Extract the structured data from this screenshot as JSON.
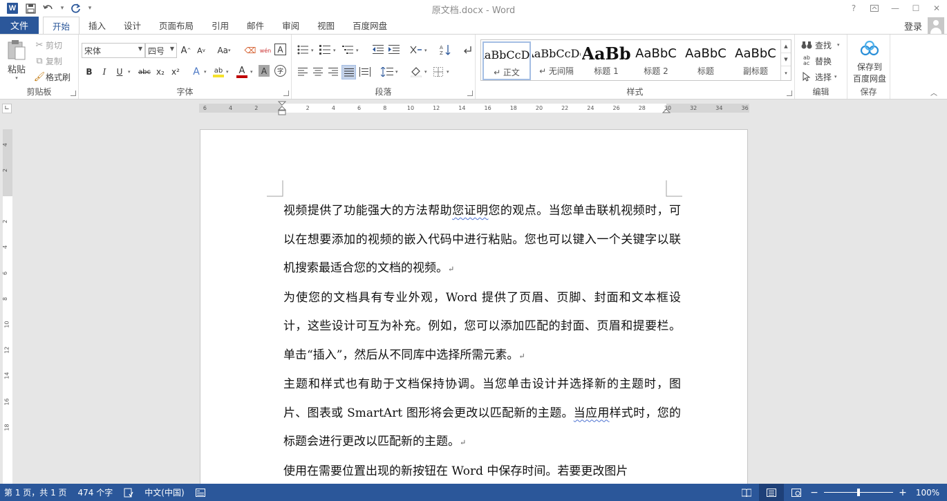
{
  "window": {
    "title": "原文档.docx - Word",
    "help_icon": "?",
    "ribbon_display_icon": "ribbon-display-icon",
    "minimize_icon": "—",
    "maximize_icon": "☐",
    "close_icon": "✕"
  },
  "qat": {
    "logo": "W",
    "save_icon": "save-icon",
    "undo_icon": "undo-icon",
    "redo_icon": "redo-icon",
    "customize_icon": "customize-qat-icon"
  },
  "tabs": [
    {
      "label": "文件",
      "type": "file"
    },
    {
      "label": "开始",
      "active": true
    },
    {
      "label": "插入"
    },
    {
      "label": "设计"
    },
    {
      "label": "页面布局"
    },
    {
      "label": "引用"
    },
    {
      "label": "邮件"
    },
    {
      "label": "审阅"
    },
    {
      "label": "视图"
    },
    {
      "label": "百度网盘"
    }
  ],
  "account": {
    "login_label": "登录"
  },
  "ribbon": {
    "clipboard": {
      "label": "剪贴板",
      "paste": "粘贴",
      "cut": "剪切",
      "copy": "复制",
      "format_painter": "格式刷"
    },
    "font": {
      "label": "字体",
      "font_name": "宋体",
      "font_size": "四号",
      "grow": "A",
      "shrink": "A",
      "change_case": "Aa",
      "pinyin": "wén",
      "border_char": "A",
      "bold": "B",
      "italic": "I",
      "underline": "U",
      "strike": "abc",
      "subscript": "x₂",
      "superscript": "x²",
      "text_effect": "A",
      "highlight": "ab",
      "font_color": "A",
      "char_shading": "A",
      "enclose": "字"
    },
    "paragraph": {
      "label": "段落"
    },
    "styles": {
      "label": "样式",
      "items": [
        {
          "sample": "AaBbCcDd",
          "name": "↵ 正文",
          "selected": true,
          "size": 16
        },
        {
          "sample": "AaBbCcDd",
          "name": "↵ 无间隔",
          "size": 16
        },
        {
          "sample": "AaBb",
          "name": "标题 1",
          "size": 24,
          "bold": true
        },
        {
          "sample": "AaBbC",
          "name": "标题 2",
          "size": 18
        },
        {
          "sample": "AaBbC",
          "name": "标题",
          "size": 18
        },
        {
          "sample": "AaBbC",
          "name": "副标题",
          "size": 18
        }
      ]
    },
    "editing": {
      "label": "编辑",
      "find": "查找",
      "replace": "替换",
      "select": "选择"
    },
    "save": {
      "label": "保存",
      "button_line1": "保存到",
      "button_line2": "百度网盘"
    }
  },
  "ruler": {
    "horizontal_ticks": [
      "6",
      "4",
      "2",
      "2",
      "4",
      "6",
      "8",
      "10",
      "12",
      "14",
      "16",
      "18",
      "20",
      "22",
      "24",
      "26",
      "28",
      "30",
      "32",
      "34",
      "36"
    ],
    "vertical_ticks": [
      "4",
      "2",
      "2",
      "4",
      "6",
      "8",
      "10",
      "12",
      "14",
      "16",
      "18"
    ]
  },
  "document": {
    "paragraphs": [
      {
        "before": "视频提供了功能强大的方法帮助",
        "squiggly": "您证明",
        "after": "您的观点。当您单击联机视频时，可以在想要添加的视频的嵌入代码中进行粘贴。您也可以键入一个关键字以联机搜索最适合您的文档的视频。"
      },
      {
        "before": "为使您的文档具有专业外观，Word 提供了页眉、页脚、封面和文本框设计，这些设计可互为补充。例如，您可以添加匹配的封面、页眉和提要栏。单击“插入”，然后从不同库中选择所需元素。",
        "squiggly": "",
        "after": ""
      },
      {
        "before": "主题和样式也有助于文档保持协调。当您单击设计并选择新的主题时，图片、图表或 SmartArt 图形将会更改以匹配新的主题。",
        "squiggly": "当应用",
        "after": "样式时，您的标题会进行更改以匹配新的主题。"
      },
      {
        "before": "使用在需要位置出现的新按钮在 Word 中保存时间。若要更改图片",
        "squiggly": "",
        "after": "",
        "no_mark": true
      }
    ],
    "paragraph_mark": "↵"
  },
  "status": {
    "page": "第 1 页，共 1 页",
    "words": "474 个字",
    "proofing_icon": "proofing-icon",
    "language": "中文(中国)",
    "macro_icon": "macro-icon",
    "zoom_out": "−",
    "zoom_in": "+",
    "zoom": "100%",
    "zoom_fraction": 0.5
  }
}
